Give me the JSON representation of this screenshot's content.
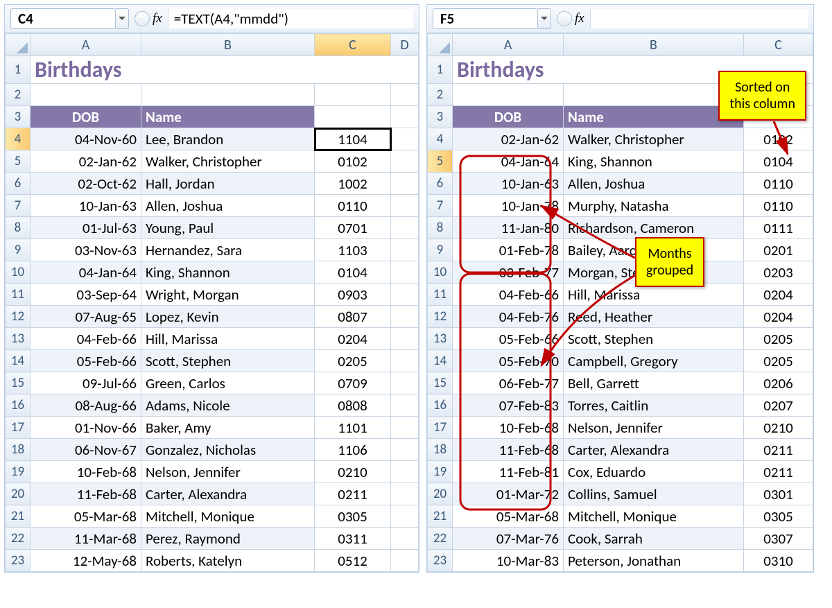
{
  "panel1": {
    "namebox": "C4",
    "formula": "=TEXT(A4,\"mmdd\")",
    "cols": [
      "A",
      "B",
      "C",
      "D"
    ],
    "title": "Birthdays",
    "headers": {
      "dob": "DOB",
      "name": "Name"
    },
    "sel_row": 4,
    "rows": [
      {
        "n": 4,
        "dob": "04-Nov-60",
        "name": "Lee, Brandon",
        "c": "1104"
      },
      {
        "n": 5,
        "dob": "02-Jan-62",
        "name": "Walker, Christopher",
        "c": "0102"
      },
      {
        "n": 6,
        "dob": "02-Oct-62",
        "name": "Hall, Jordan",
        "c": "1002"
      },
      {
        "n": 7,
        "dob": "10-Jan-63",
        "name": "Allen, Joshua",
        "c": "0110"
      },
      {
        "n": 8,
        "dob": "01-Jul-63",
        "name": "Young, Paul",
        "c": "0701"
      },
      {
        "n": 9,
        "dob": "03-Nov-63",
        "name": "Hernandez, Sara",
        "c": "1103"
      },
      {
        "n": 10,
        "dob": "04-Jan-64",
        "name": "King, Shannon",
        "c": "0104"
      },
      {
        "n": 11,
        "dob": "03-Sep-64",
        "name": "Wright, Morgan",
        "c": "0903"
      },
      {
        "n": 12,
        "dob": "07-Aug-65",
        "name": "Lopez, Kevin",
        "c": "0807"
      },
      {
        "n": 13,
        "dob": "04-Feb-66",
        "name": "Hill, Marissa",
        "c": "0204"
      },
      {
        "n": 14,
        "dob": "05-Feb-66",
        "name": "Scott, Stephen",
        "c": "0205"
      },
      {
        "n": 15,
        "dob": "09-Jul-66",
        "name": "Green, Carlos",
        "c": "0709"
      },
      {
        "n": 16,
        "dob": "08-Aug-66",
        "name": "Adams, Nicole",
        "c": "0808"
      },
      {
        "n": 17,
        "dob": "01-Nov-66",
        "name": "Baker, Amy",
        "c": "1101"
      },
      {
        "n": 18,
        "dob": "06-Nov-67",
        "name": "Gonzalez, Nicholas",
        "c": "1106"
      },
      {
        "n": 19,
        "dob": "10-Feb-68",
        "name": "Nelson, Jennifer",
        "c": "0210"
      },
      {
        "n": 20,
        "dob": "11-Feb-68",
        "name": "Carter, Alexandra",
        "c": "0211"
      },
      {
        "n": 21,
        "dob": "05-Mar-68",
        "name": "Mitchell, Monique",
        "c": "0305"
      },
      {
        "n": 22,
        "dob": "11-Mar-68",
        "name": "Perez, Raymond",
        "c": "0311"
      },
      {
        "n": 23,
        "dob": "12-May-68",
        "name": "Roberts, Katelyn",
        "c": "0512"
      }
    ]
  },
  "panel2": {
    "namebox": "F5",
    "formula": "",
    "cols": [
      "A",
      "B",
      "C"
    ],
    "title": "Birthdays",
    "headers": {
      "dob": "DOB",
      "name": "Name"
    },
    "sel_row": 5,
    "rows": [
      {
        "n": 4,
        "dob": "02-Jan-62",
        "name": "Walker, Christopher",
        "c": "0102"
      },
      {
        "n": 5,
        "dob": "04-Jan-64",
        "name": "King, Shannon",
        "c": "0104"
      },
      {
        "n": 6,
        "dob": "10-Jan-63",
        "name": "Allen, Joshua",
        "c": "0110"
      },
      {
        "n": 7,
        "dob": "10-Jan-78",
        "name": "Murphy, Natasha",
        "c": "0110"
      },
      {
        "n": 8,
        "dob": "11-Jan-80",
        "name": "Richardson, Cameron",
        "c": "0111"
      },
      {
        "n": 9,
        "dob": "01-Feb-78",
        "name": "Bailey, Aaron",
        "c": "0201"
      },
      {
        "n": 10,
        "dob": "03-Feb-77",
        "name": "Morgan, Steven",
        "c": "0203"
      },
      {
        "n": 11,
        "dob": "04-Feb-66",
        "name": "Hill, Marissa",
        "c": "0204"
      },
      {
        "n": 12,
        "dob": "04-Feb-76",
        "name": "Reed, Heather",
        "c": "0204"
      },
      {
        "n": 13,
        "dob": "05-Feb-66",
        "name": "Scott, Stephen",
        "c": "0205"
      },
      {
        "n": 14,
        "dob": "05-Feb-70",
        "name": "Campbell, Gregory",
        "c": "0205"
      },
      {
        "n": 15,
        "dob": "06-Feb-77",
        "name": "Bell, Garrett",
        "c": "0206"
      },
      {
        "n": 16,
        "dob": "07-Feb-83",
        "name": "Torres, Caitlin",
        "c": "0207"
      },
      {
        "n": 17,
        "dob": "10-Feb-68",
        "name": "Nelson, Jennifer",
        "c": "0210"
      },
      {
        "n": 18,
        "dob": "11-Feb-68",
        "name": "Carter, Alexandra",
        "c": "0211"
      },
      {
        "n": 19,
        "dob": "11-Feb-81",
        "name": "Cox, Eduardo",
        "c": "0211"
      },
      {
        "n": 20,
        "dob": "01-Mar-72",
        "name": "Collins, Samuel",
        "c": "0301"
      },
      {
        "n": 21,
        "dob": "05-Mar-68",
        "name": "Mitchell, Monique",
        "c": "0305"
      },
      {
        "n": 22,
        "dob": "07-Mar-76",
        "name": "Cook, Sarrah",
        "c": "0307"
      },
      {
        "n": 23,
        "dob": "10-Mar-83",
        "name": "Peterson, Jonathan",
        "c": "0310"
      }
    ]
  },
  "callouts": {
    "sorted": "Sorted on\nthis column",
    "months": "Months\ngrouped"
  },
  "fx_label": "fx"
}
